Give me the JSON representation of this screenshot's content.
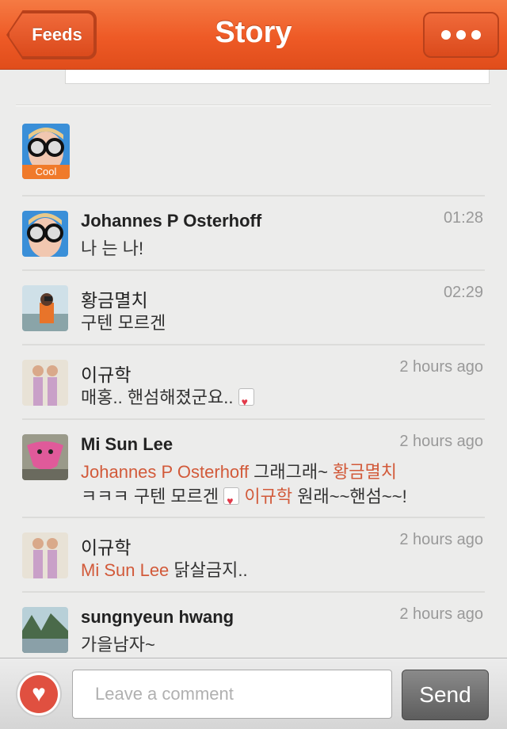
{
  "header": {
    "back_label": "Feeds",
    "title": "Story",
    "more_icon": "more-dots-icon"
  },
  "me": {
    "badge": "Cool"
  },
  "comments": [
    {
      "author": "Johannes P Osterhoff",
      "time": "01:28",
      "text": "나 는 나!"
    },
    {
      "author": "황금멸치",
      "time": "02:29",
      "text": "구텐 모르겐"
    },
    {
      "author": "이규학",
      "time": "2 hours ago",
      "text": "매홍.. 핸섬해졌군요.."
    },
    {
      "author": "Mi Sun Lee",
      "time": "2 hours ago",
      "mention1": "Johannes P Osterhoff",
      "text1": " 그래그래~ ",
      "mention2": "황금멸치",
      "text2": "ㅋㅋㅋ 구텐 모르겐 ",
      "mention3": "이규학",
      "text3": " 원래~~핸섬~~!"
    },
    {
      "author": "이규학",
      "time": "2 hours ago",
      "mention": "Mi Sun Lee",
      "text": " 닭살금지.."
    },
    {
      "author": "sungnyeun hwang",
      "time": "2 hours ago",
      "text": "가을남자~"
    }
  ],
  "composer": {
    "placeholder": "Leave a comment",
    "send_label": "Send",
    "like_icon": "heart-icon"
  },
  "colors": {
    "header": "#ee5a26",
    "mention": "#d25a3a",
    "badge": "#f07a2a"
  }
}
